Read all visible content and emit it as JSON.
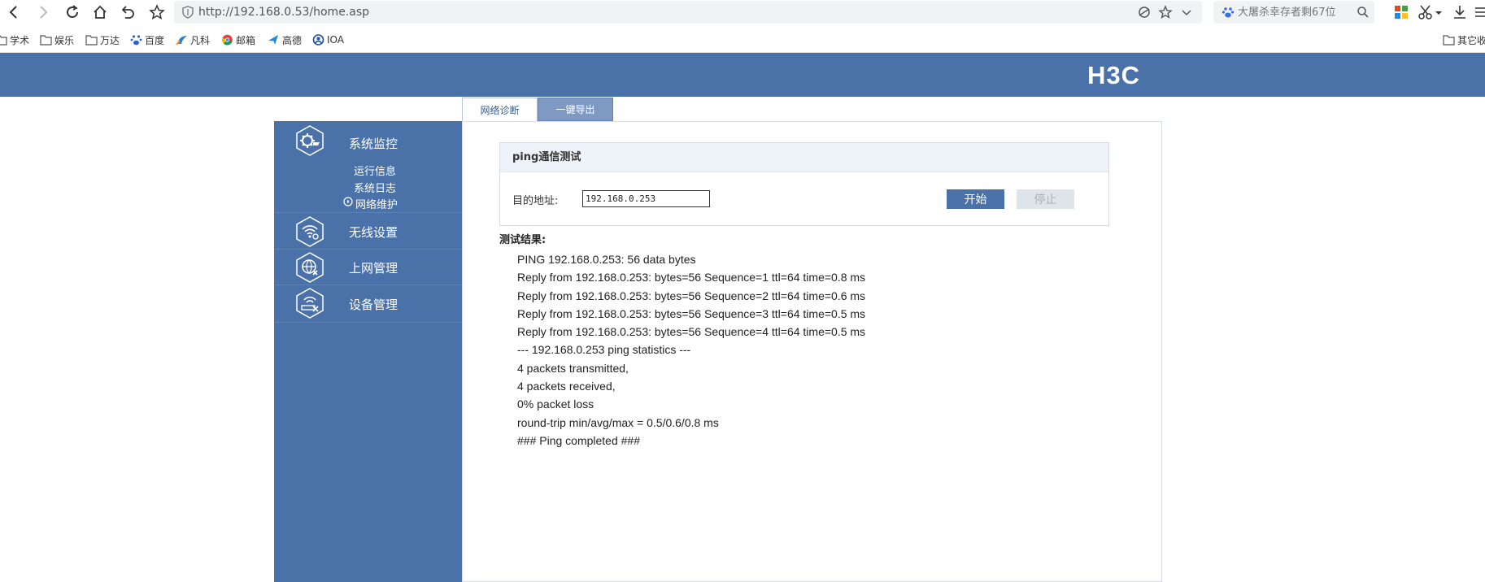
{
  "browser": {
    "url": "http://192.168.0.53/home.asp",
    "search_placeholder": "大屠杀幸存者剩67位",
    "bookmarks": [
      {
        "label": "学术"
      },
      {
        "label": "娱乐"
      },
      {
        "label": "万达"
      },
      {
        "label": "百度"
      },
      {
        "label": "凡科"
      },
      {
        "label": "邮箱"
      },
      {
        "label": "高德"
      },
      {
        "label": "IOA"
      }
    ],
    "other_bookmarks": "其它收"
  },
  "header": {
    "logo": "H3C"
  },
  "tabs": [
    {
      "label": "网络诊断",
      "active": true
    },
    {
      "label": "一键导出",
      "active": false
    }
  ],
  "sidebar": {
    "groups": [
      {
        "title": "系统监控",
        "icon": "monitor-gear-icon",
        "items": [
          {
            "label": "运行信息"
          },
          {
            "label": "系统日志"
          },
          {
            "label": "网络维护",
            "active": true
          }
        ]
      },
      {
        "title": "无线设置",
        "icon": "wifi-settings-icon"
      },
      {
        "title": "上网管理",
        "icon": "globe-settings-icon"
      },
      {
        "title": "设备管理",
        "icon": "router-settings-icon"
      }
    ]
  },
  "ping": {
    "panel_title": "ping通信测试",
    "dest_label": "目的地址:",
    "dest_value": "192.168.0.253",
    "start_label": "开始",
    "stop_label": "停止"
  },
  "result": {
    "label": "测试结果:",
    "lines": [
      "PING 192.168.0.253: 56 data bytes",
      "Reply from 192.168.0.253: bytes=56 Sequence=1 ttl=64 time=0.8 ms",
      "Reply from 192.168.0.253: bytes=56 Sequence=2 ttl=64 time=0.6 ms",
      "Reply from 192.168.0.253: bytes=56 Sequence=3 ttl=64 time=0.5 ms",
      "Reply from 192.168.0.253: bytes=56 Sequence=4 ttl=64 time=0.5 ms",
      "--- 192.168.0.253 ping statistics ---",
      "4 packets transmitted,",
      "4 packets received,",
      "0% packet loss",
      "round-trip min/avg/max = 0.5/0.6/0.8 ms",
      "### Ping completed ###"
    ]
  },
  "colors": {
    "brand_blue": "#4a72a8",
    "tab_inactive": "#7e9ac2",
    "panel_header": "#eef3f9"
  }
}
